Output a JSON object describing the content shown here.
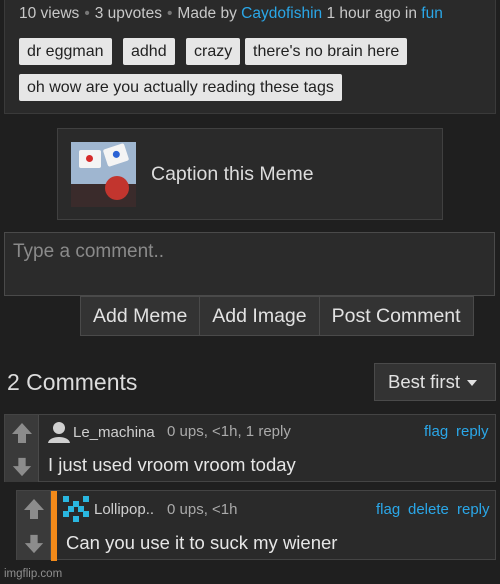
{
  "meta": {
    "views": "10 views",
    "upvotes": "3 upvotes",
    "made_by_label": "Made by",
    "author": "Caydofishin",
    "time": "1 hour ago in",
    "stream": "fun"
  },
  "tags": [
    "dr eggman",
    "adhd",
    "crazy",
    "there's no brain here",
    "oh wow are you actually reading these tags"
  ],
  "caption": {
    "label": "Caption this Meme"
  },
  "comment_box": {
    "placeholder": "Type a comment.."
  },
  "buttons": {
    "add_meme": "Add Meme",
    "add_image": "Add Image",
    "post_comment": "Post Comment"
  },
  "comments_header": {
    "count": "2 Comments",
    "sort": "Best first"
  },
  "comments": [
    {
      "user": "Le_machina",
      "meta": "0 ups, <1h, 1 reply",
      "actions": [
        "flag",
        "reply"
      ],
      "text": "I just used vroom vroom today"
    },
    {
      "user": "Lollipop..",
      "meta": "0 ups, <1h",
      "actions": [
        "flag",
        "delete",
        "reply"
      ],
      "text": "Can you use it to suck my wiener"
    }
  ],
  "footer": "imgflip.com",
  "colors": {
    "link": "#2aa7e8",
    "reply_stripe": "#f28a1a",
    "background": "#1f1f1f"
  }
}
